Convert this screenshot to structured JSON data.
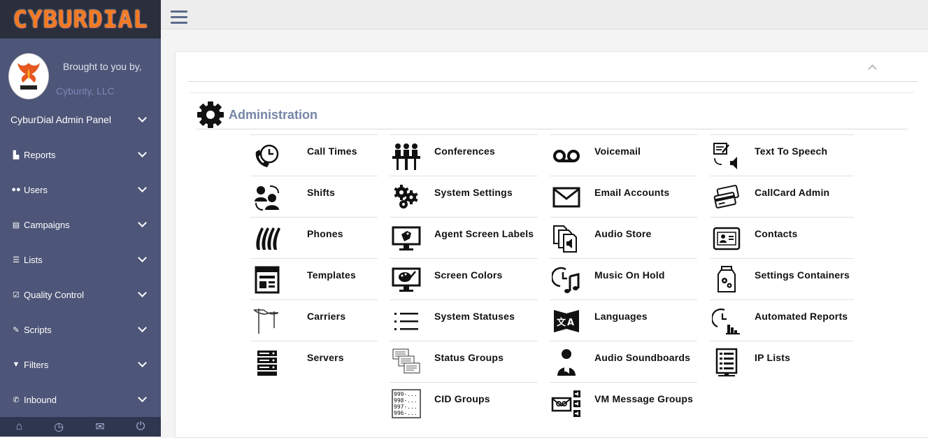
{
  "logo": {
    "text": "CYBURDIAL"
  },
  "brand": {
    "brought": "Brought to you by,",
    "company": "Cyburity, LLC"
  },
  "nav": {
    "panel": "CyburDial Admin Panel",
    "items": [
      {
        "label": "Reports",
        "icon": "bar-chart-icon"
      },
      {
        "label": "Users",
        "icon": "users-icon"
      },
      {
        "label": "Campaigns",
        "icon": "table-icon"
      },
      {
        "label": "Lists",
        "icon": "list-icon"
      },
      {
        "label": "Quality Control",
        "icon": "check-square-icon"
      },
      {
        "label": "Scripts",
        "icon": "edit-icon"
      },
      {
        "label": "Filters",
        "icon": "filter-icon"
      },
      {
        "label": "Inbound",
        "icon": "phone-in-icon"
      }
    ]
  },
  "footer": {
    "icons": [
      "home-icon",
      "clock-icon",
      "envelope-icon",
      "power-icon"
    ]
  },
  "section": {
    "title": "Administration"
  },
  "columns": [
    [
      {
        "label": "Call Times",
        "icon": "phone-clock-icon"
      },
      {
        "label": "Shifts",
        "icon": "people-swap-icon"
      },
      {
        "label": "Phones",
        "icon": "phones-icon"
      },
      {
        "label": "Templates",
        "icon": "template-icon"
      },
      {
        "label": "Carriers",
        "icon": "telephone-pole-icon"
      },
      {
        "label": "Servers",
        "icon": "server-rack-icon"
      }
    ],
    [
      {
        "label": "Conferences",
        "icon": "conference-icon"
      },
      {
        "label": "System Settings",
        "icon": "gears-icon"
      },
      {
        "label": "Agent Screen Labels",
        "icon": "monitor-tag-icon"
      },
      {
        "label": "Screen Colors",
        "icon": "monitor-palette-icon"
      },
      {
        "label": "System Statuses",
        "icon": "bullet-list-icon"
      },
      {
        "label": "Status Groups",
        "icon": "stacked-docs-icon"
      },
      {
        "label": "CID Groups",
        "icon": "cid-list-icon"
      }
    ],
    [
      {
        "label": "Voicemail",
        "icon": "voicemail-icon"
      },
      {
        "label": "Email Accounts",
        "icon": "envelope-icon"
      },
      {
        "label": "Audio Store",
        "icon": "audio-files-icon"
      },
      {
        "label": "Music On Hold",
        "icon": "music-clock-icon"
      },
      {
        "label": "Languages",
        "icon": "translate-icon"
      },
      {
        "label": "Audio Soundboards",
        "icon": "speaker-person-icon"
      },
      {
        "label": "VM Message Groups",
        "icon": "voicemail-group-icon"
      }
    ],
    [
      {
        "label": "Text To Speech",
        "icon": "text-speech-icon"
      },
      {
        "label": "CallCard Admin",
        "icon": "callcard-icon"
      },
      {
        "label": "Contacts",
        "icon": "contact-card-icon"
      },
      {
        "label": "Settings Containers",
        "icon": "settings-jar-icon"
      },
      {
        "label": "Automated Reports",
        "icon": "auto-report-icon"
      },
      {
        "label": "IP Lists",
        "icon": "ip-list-icon"
      }
    ]
  ]
}
